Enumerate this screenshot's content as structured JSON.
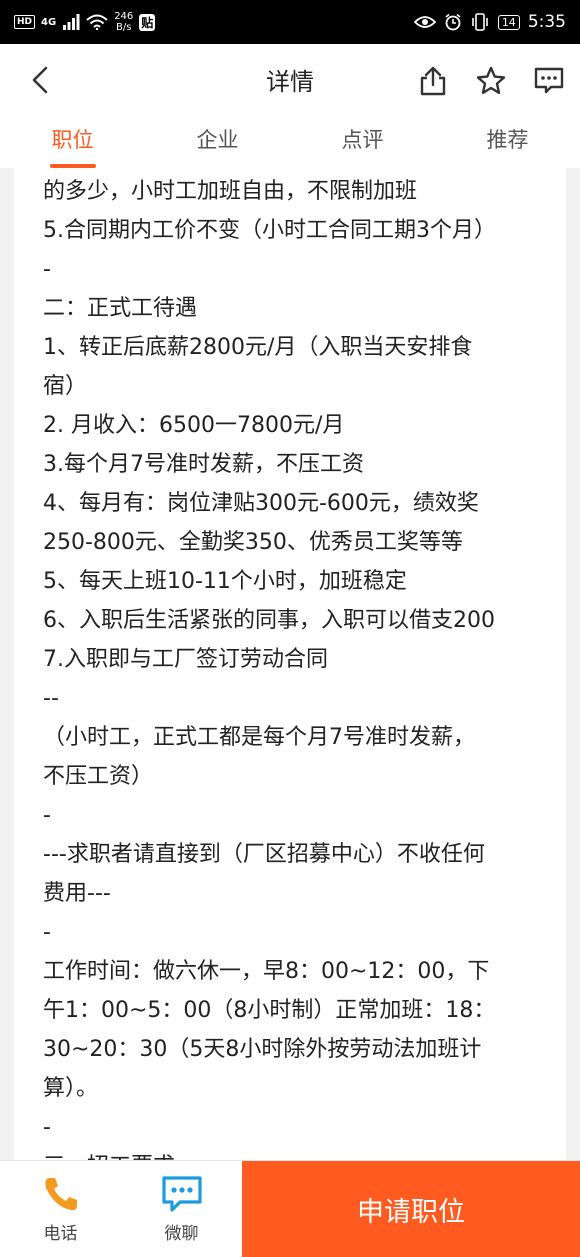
{
  "status_bar": {
    "network_label": "HD",
    "signal_label": "4G",
    "speed_value": "246",
    "speed_unit": "B/s",
    "tie_label": "贴",
    "battery": "14",
    "time": "5:35"
  },
  "header": {
    "title": "详情"
  },
  "tabs": [
    {
      "label": "职位",
      "active": true
    },
    {
      "label": "企业",
      "active": false
    },
    {
      "label": "点评",
      "active": false
    },
    {
      "label": "推荐",
      "active": false
    }
  ],
  "content": {
    "lines": [
      "的多少，小时工加班自由，不限制加班",
      "5.合同期内工价不变（小时工合同工期3个月）",
      "-",
      "二：正式工待遇",
      "1、转正后底薪2800元/月（入职当天安排食",
      "宿）",
      "2. 月收入：6500一7800元/月",
      "3.每个月7号准时发薪，不压工资",
      "4、每月有：岗位津贴300元-600元，绩效奖",
      "250-800元、全勤奖350、优秀员工奖等等",
      "5、每天上班10-11个小时，加班稳定",
      "6、入职后生活紧张的同事，入职可以借支200",
      "7.入职即与工厂签订劳动合同",
      "--",
      "（小时工，正式工都是每个月7号准时发薪，",
      "不压工资）",
      "-",
      "---求职者请直接到（厂区招募中心）不收任何",
      "费用---",
      "-",
      "工作时间：做六休一，早8：00~12：00，下",
      "午1：00~5：00（8小时制）正常加班：18：",
      "30~20：30（5天8小时除外按劳动法加班计",
      "算）。",
      "-",
      "三、招工要求"
    ]
  },
  "bottom_bar": {
    "phone_label": "电话",
    "chat_label": "微聊",
    "apply_label": "申请职位"
  },
  "colors": {
    "accent": "#ff5a1f",
    "icon_orange": "#f39a1f",
    "icon_blue": "#1e9be0"
  }
}
